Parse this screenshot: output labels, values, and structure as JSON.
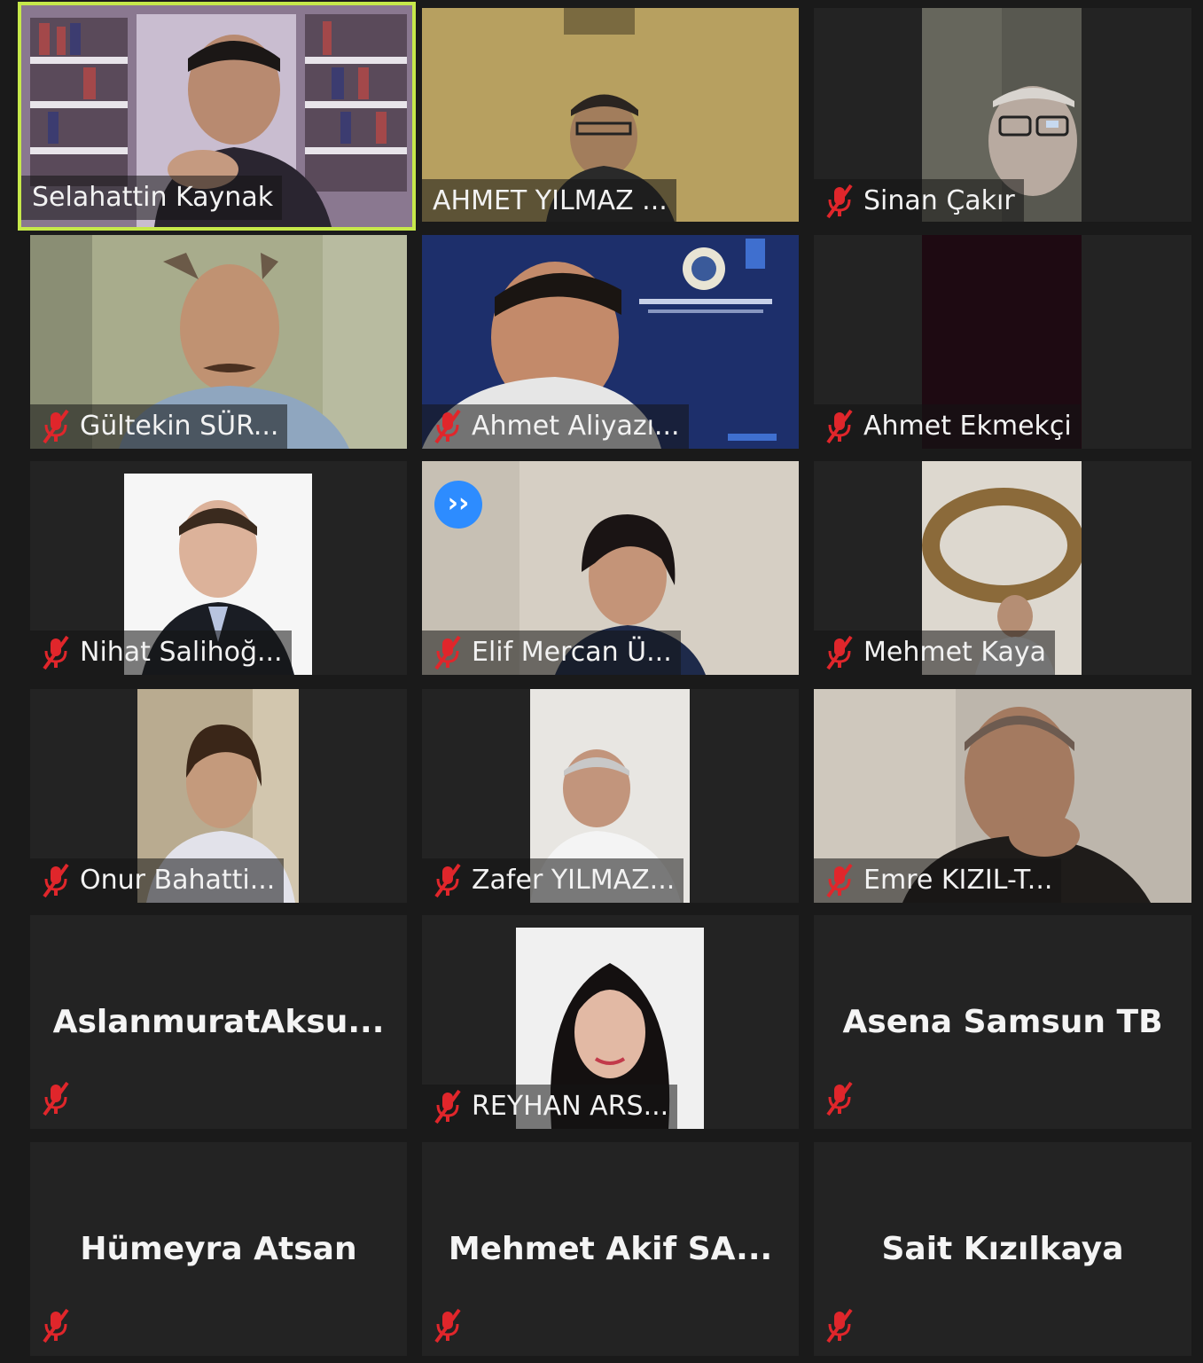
{
  "participants": [
    {
      "name": "Selahattin Kaynak",
      "muted": false,
      "active_speaker": true
    },
    {
      "name": "AHMET YILMAZ ...",
      "muted": false
    },
    {
      "name": "Sinan Çakır",
      "muted": true
    },
    {
      "name": "Gültekin SÜR...",
      "muted": true
    },
    {
      "name": "Ahmet Aliyazı...",
      "muted": true
    },
    {
      "name": "Ahmet Ekmekçi",
      "muted": true
    },
    {
      "name": "Nihat Salihoğ...",
      "muted": true
    },
    {
      "name": "Elif Mercan Ü...",
      "muted": true
    },
    {
      "name": "Mehmet Kaya",
      "muted": true
    },
    {
      "name": "Onur Bahatti...",
      "muted": true
    },
    {
      "name": "Zafer YILMAZ...",
      "muted": true
    },
    {
      "name": "Emre KIZIL-T...",
      "muted": true
    },
    {
      "name": "AslanmuratAksu...",
      "muted": true
    },
    {
      "name": "REYHAN ARS...",
      "muted": true
    },
    {
      "name": "Asena Samsun TB",
      "muted": true
    },
    {
      "name": "Hümeyra Atsan",
      "muted": true
    },
    {
      "name": "Mehmet Akif SA...",
      "muted": true
    },
    {
      "name": "Sait Kızılkaya",
      "muted": true
    }
  ],
  "badges": {
    "forward_icon_text": "››"
  },
  "colors": {
    "active_outline": "#c6e84a",
    "mute_red": "#e0262b",
    "tile_bg": "#232323",
    "badge_blue": "#2d8cff"
  },
  "icons": {
    "mute": "muted-microphone-icon",
    "forward": "fast-forward-icon"
  }
}
